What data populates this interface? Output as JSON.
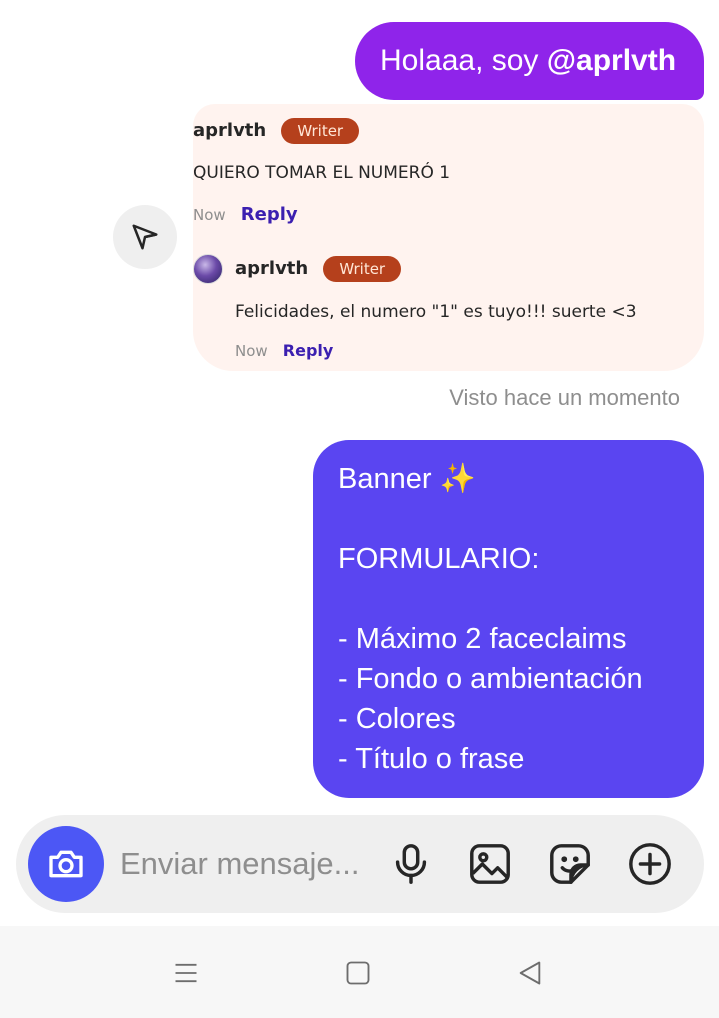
{
  "messages": {
    "sent_1": {
      "text_prefix": "Holaaa, soy ",
      "mention": "@aprlvth"
    },
    "shared_post": {
      "comment": {
        "username": "aprlvth",
        "badge": "Writer",
        "text": "QUIERO TOMAR EL NUMERÓ 1",
        "time": "Now",
        "reply_label": "Reply"
      },
      "reply": {
        "username": "aprlvth",
        "badge": "Writer",
        "text": "Felicidades, el numero \"1\" es tuyo!!! suerte <3",
        "time": "Now",
        "reply_label": "Reply"
      }
    },
    "seen_status": "Visto hace un momento",
    "sent_2": {
      "lines": [
        "Banner ✨",
        "",
        "FORMULARIO:",
        "",
        "- Máximo 2 faceclaims",
        "- Fondo o ambientación",
        "- Colores",
        "- Título o frase"
      ]
    }
  },
  "composer": {
    "placeholder": "Enviar mensaje...",
    "icons": [
      "camera-icon",
      "microphone-icon",
      "gallery-icon",
      "sticker-icon",
      "add-icon"
    ],
    "camera_color": "#4c57f5"
  },
  "navbar": {
    "icons": [
      "menu-icon",
      "home-icon",
      "back-icon"
    ]
  },
  "colors": {
    "sent_1": "#8f24ea",
    "sent_2": "#5a45f1",
    "badge": "#b5401c",
    "card_bg": "#fff3ef"
  }
}
